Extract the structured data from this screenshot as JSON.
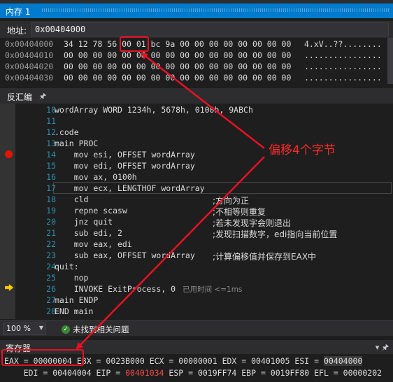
{
  "memory": {
    "tab_title": "内存 1",
    "address_label": "地址:",
    "address_value": "0x00404000",
    "rows": [
      {
        "addr": "0x00404000",
        "bytes": "34 12 78 56 00 01 bc 9a 00 00 00 00 00 00 00 00",
        "ascii": "4.xV..??........"
      },
      {
        "addr": "0x00404010",
        "bytes": "00 00 00 00 00 00 00 00 00 00 00 00 00 00 00 00",
        "ascii": "................"
      },
      {
        "addr": "0x00404020",
        "bytes": "00 00 00 00 00 00 00 00 00 00 00 00 00 00 00 00",
        "ascii": "................"
      },
      {
        "addr": "0x00404030",
        "bytes": "00 00 00 00 00 00 00 00 00 00 00 00 00 00 00 00",
        "ascii": "................"
      }
    ]
  },
  "disassembly": {
    "title": "反汇编",
    "pin_icon": "pin-icon",
    "lines": [
      {
        "n": "10",
        "code": "wordArray WORD 1234h, 5678h, 0100h, 9ABCh",
        "comment": ""
      },
      {
        "n": "11",
        "code": "",
        "comment": ""
      },
      {
        "n": "12",
        "code": ".code",
        "comment": ""
      },
      {
        "n": "13",
        "code": "main PROC",
        "comment": ""
      },
      {
        "n": "14",
        "code": "    mov esi, OFFSET wordArray",
        "comment": ""
      },
      {
        "n": "15",
        "code": "    mov edi, OFFSET wordArray",
        "comment": ""
      },
      {
        "n": "16",
        "code": "    mov ax, 0100h",
        "comment": ""
      },
      {
        "n": "17",
        "code": "    mov ecx, LENGTHOF wordArray",
        "comment": ""
      },
      {
        "n": "18",
        "code": "    cld",
        "comment": ";方向为正"
      },
      {
        "n": "19",
        "code": "    repne scasw",
        "comment": ";不相等则重复"
      },
      {
        "n": "20",
        "code": "    jnz quit",
        "comment": ";若未发现字会则退出"
      },
      {
        "n": "21",
        "code": "    sub edi, 2",
        "comment": ";发现扫描数字，edi指向当前位置"
      },
      {
        "n": "22",
        "code": "    mov eax, edi",
        "comment": ""
      },
      {
        "n": "23",
        "code": "    sub eax, OFFSET wordArray",
        "comment": ";计算偏移值并保存到EAX中"
      },
      {
        "n": "24",
        "code": "quit:",
        "comment": ""
      },
      {
        "n": "25",
        "code": "    nop",
        "comment": ""
      },
      {
        "n": "26",
        "code": "    INVOKE ExitProcess, 0",
        "comment": "",
        "hint": "已用时间 <=1ms"
      },
      {
        "n": "27",
        "code": "main ENDP",
        "comment": ""
      },
      {
        "n": "28",
        "code": "END main",
        "comment": ""
      }
    ]
  },
  "status": {
    "zoom": "100 %",
    "issues": "未找到相关问题"
  },
  "registers": {
    "title": "寄存器",
    "line1": {
      "eax": "EAX = 00000004",
      "rest": " EBX = 0023B000 ECX = 00000001 EDX = 00401005 ESI = ",
      "esi": "00404000"
    },
    "line2": {
      "a": "    EDI = 00404004 EIP = ",
      "eip": "00401034",
      "b": " ESP = 0019FF74 EBP = 0019FF80 EFL = 00000202"
    }
  },
  "annotation": {
    "text": "偏移4个字节",
    "color": "#ff2a2a"
  }
}
